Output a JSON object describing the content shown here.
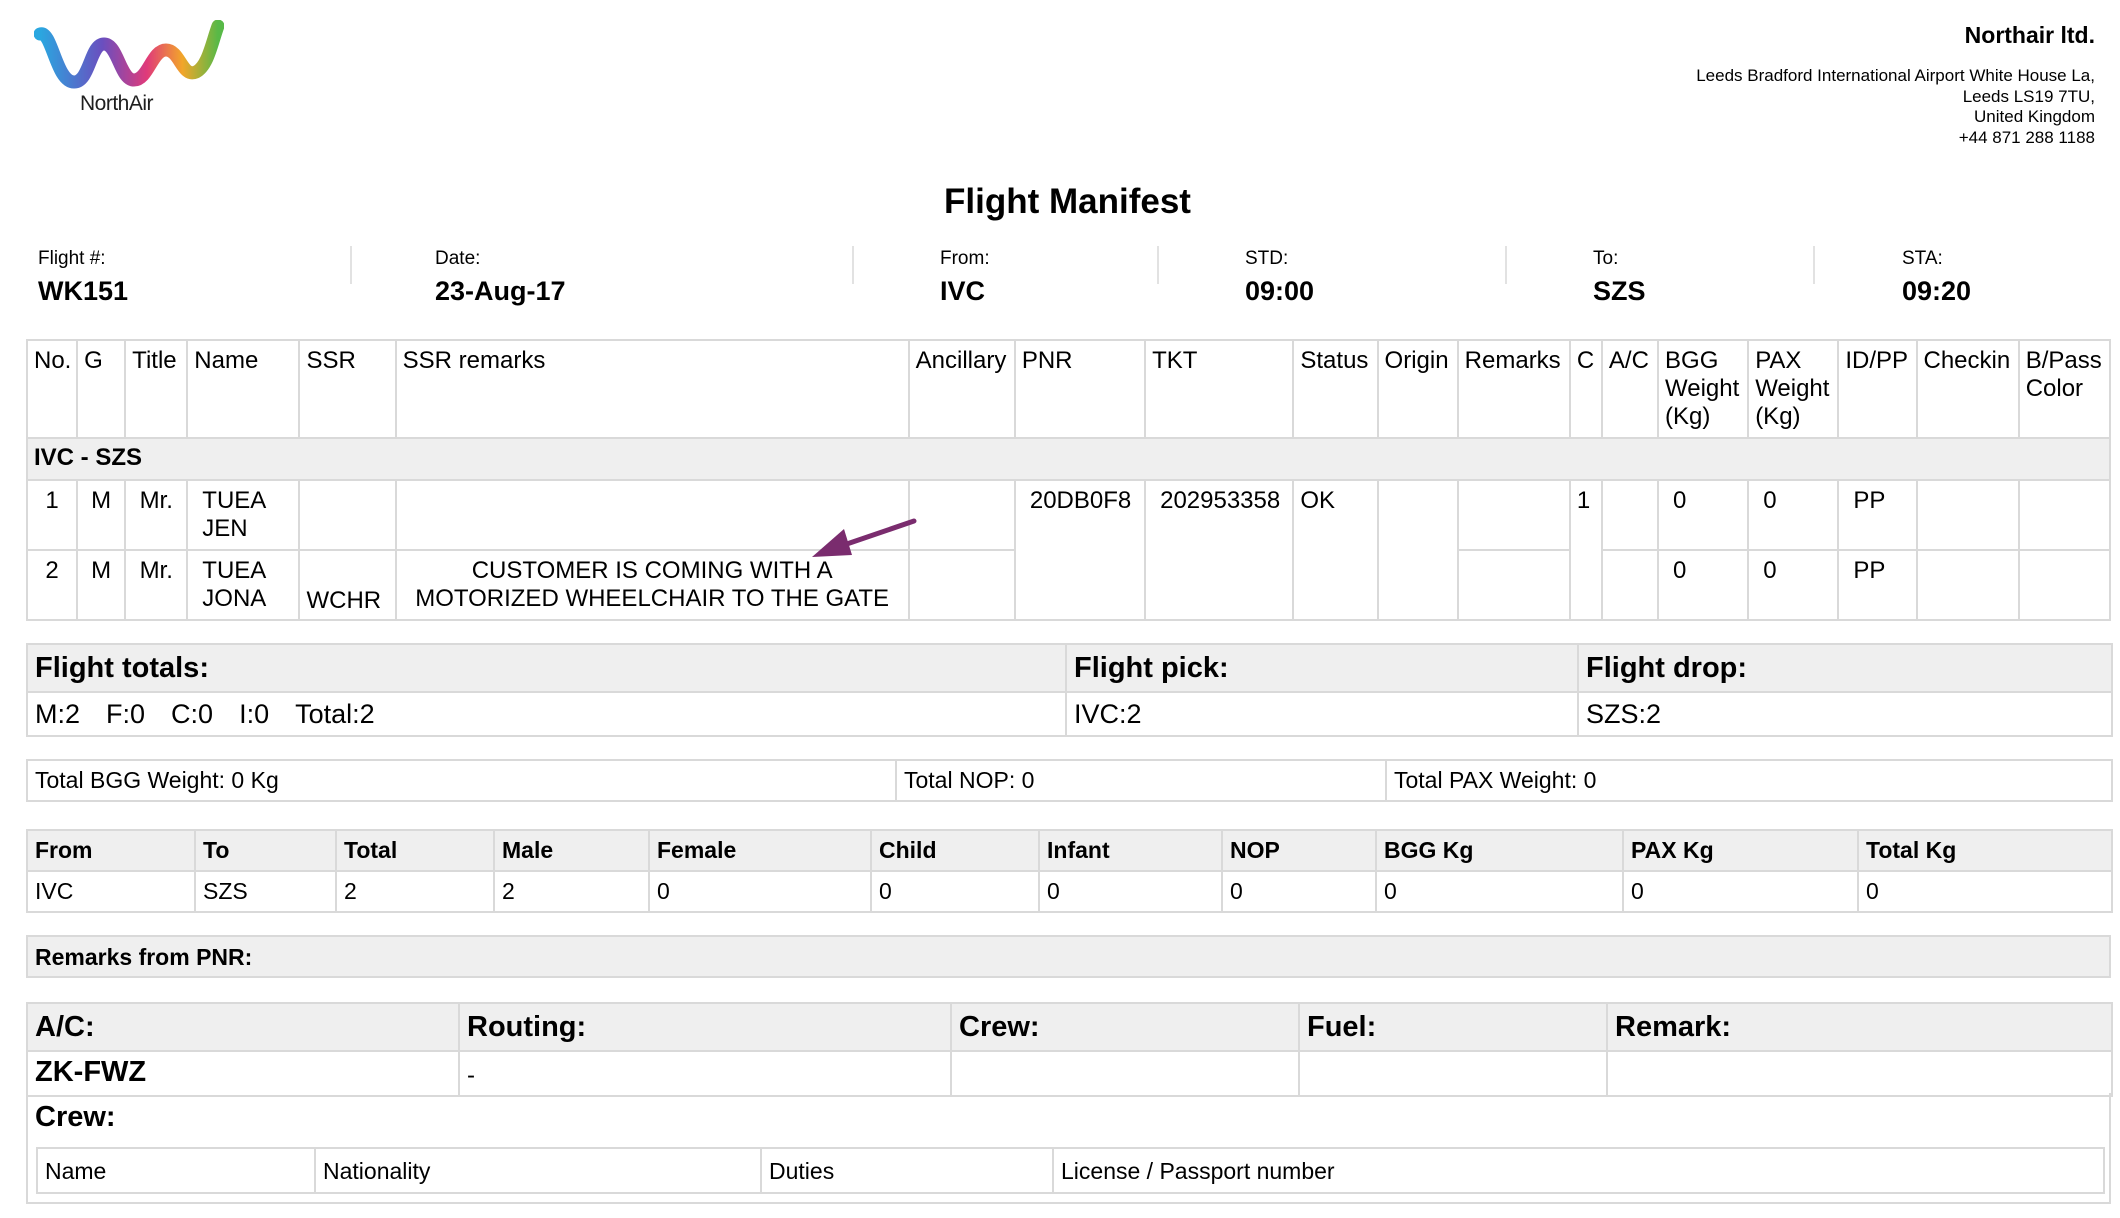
{
  "brand": {
    "logo_text": "NorthAir",
    "arrow_color": "#7a2c6e"
  },
  "company": {
    "name": "Northair ltd.",
    "address_lines": [
      "Leeds Bradford International Airport White House La,",
      "Leeds LS19 7TU,",
      "United Kingdom",
      "+44 871 288 1188"
    ]
  },
  "title": "Flight Manifest",
  "flight_info": [
    {
      "label": "Flight #:",
      "value": "WK151"
    },
    {
      "label": "Date:",
      "value": "23-Aug-17"
    },
    {
      "label": "From:",
      "value": "IVC"
    },
    {
      "label": "STD:",
      "value": "09:00"
    },
    {
      "label": "To:",
      "value": "SZS"
    },
    {
      "label": "STA:",
      "value": "09:20"
    }
  ],
  "manifest": {
    "headers": [
      "No.",
      "G",
      "Title",
      "Name",
      "SSR",
      "SSR remarks",
      "Ancillary",
      "PNR",
      "TKT",
      "Status",
      "Origin",
      "Remarks",
      "C",
      "A/C",
      "BGG Weight (Kg)",
      "PAX Weight (Kg)",
      "ID/PP",
      "Checkin",
      "B/Pass Color"
    ],
    "group": "IVC - SZS",
    "rows": [
      {
        "no": "1",
        "g": "M",
        "title": "Mr.",
        "name": "TUEA JEN",
        "ssr": "",
        "ssr_remarks": "",
        "ancillary": "",
        "pnr": "20DB0F8",
        "tkt": "202953358",
        "status": "OK",
        "origin": "",
        "remarks": "",
        "c": "1",
        "ac": "",
        "bgg": "0",
        "pax": "0",
        "idpp": "PP",
        "checkin": "",
        "bpass": ""
      },
      {
        "no": "2",
        "g": "M",
        "title": "Mr.",
        "name": "TUEA JONA",
        "ssr": "WCHR",
        "ssr_remarks": "CUSTOMER IS COMING WITH A MOTORIZED WHEELCHAIR TO THE GATE",
        "ancillary": "",
        "remarks": "",
        "ac": "",
        "bgg": "0",
        "pax": "0",
        "idpp": "PP",
        "checkin": "",
        "bpass": ""
      }
    ]
  },
  "totals": {
    "flight_totals_label": "Flight totals:",
    "flight_pick_label": "Flight pick:",
    "flight_drop_label": "Flight drop:",
    "m": "M:2",
    "f": "F:0",
    "c": "C:0",
    "i": "I:0",
    "total": "Total:2",
    "pick": "IVC:2",
    "drop": "SZS:2"
  },
  "weights": {
    "bgg": "Total BGG Weight: 0 Kg",
    "nop": "Total NOP: 0",
    "pax": "Total PAX Weight: 0"
  },
  "route_summary": {
    "headers": [
      "From",
      "To",
      "Total",
      "Male",
      "Female",
      "Child",
      "Infant",
      "NOP",
      "BGG Kg",
      "PAX Kg",
      "Total Kg"
    ],
    "values": [
      "IVC",
      "SZS",
      "2",
      "2",
      "0",
      "0",
      "0",
      "0",
      "0",
      "0",
      "0"
    ]
  },
  "remarks_from_pnr": "Remarks from PNR:",
  "aircraft": {
    "headers": [
      "A/C:",
      "Routing:",
      "Crew:",
      "Fuel:",
      "Remark:"
    ],
    "values": [
      "ZK-FWZ",
      "-",
      "",
      "",
      ""
    ]
  },
  "crew": {
    "title": "Crew:",
    "headers": [
      "Name",
      "Nationality",
      "Duties",
      "License / Passport number"
    ]
  }
}
